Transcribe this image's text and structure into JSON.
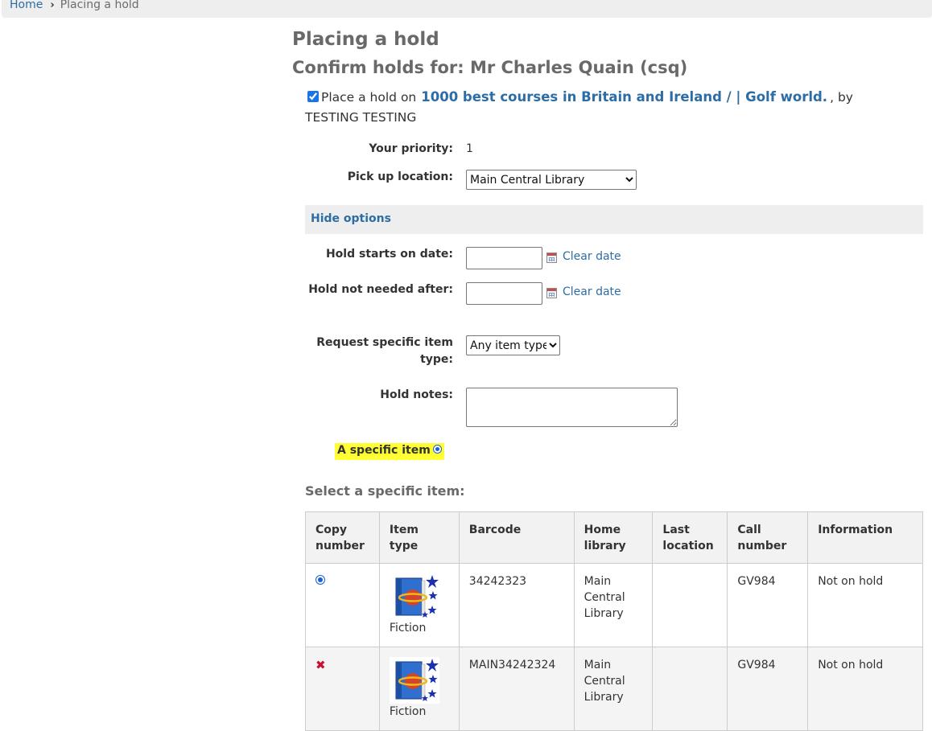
{
  "breadcrumb": {
    "home": "Home",
    "current": "Placing a hold"
  },
  "page_title": "Placing a hold",
  "subtitle": "Confirm holds for: Mr Charles Quain (csq)",
  "hold": {
    "prefix": "Place a hold on",
    "title": "1000 best courses in Britain and Ireland / | Golf world.",
    "suffix": ", by TESTING TESTING"
  },
  "priority": {
    "label": "Your priority:",
    "value": "1"
  },
  "pickup": {
    "label": "Pick up location:",
    "selected": "Main Central Library"
  },
  "options_toggle": "Hide options",
  "start_date": {
    "label": "Hold starts on date:",
    "clear": "Clear date"
  },
  "expiry_date": {
    "label": "Hold not needed after:",
    "clear": "Clear date"
  },
  "item_type": {
    "label": "Request specific item type:",
    "selected": "Any item type"
  },
  "notes": {
    "label": "Hold notes:"
  },
  "specific_item": "A specific item",
  "select_heading": "Select a specific item:",
  "table": {
    "headers": [
      "Copy number",
      "Item type",
      "Barcode",
      "Home library",
      "Last location",
      "Call number",
      "Information"
    ],
    "rows": [
      {
        "item_type": "Fiction",
        "barcode": "34242323",
        "home_library": "Main Central Library",
        "last_location": "",
        "call_number": "GV984",
        "information": "Not on hold"
      },
      {
        "item_type": "Fiction",
        "barcode": "MAIN34242324",
        "home_library": "Main Central Library",
        "last_location": "",
        "call_number": "GV984",
        "information": "Not on hold"
      }
    ]
  },
  "icons": {
    "breadcrumb_sep": "chevron-right-icon",
    "calendar": "calendar-icon",
    "item_type": "fiction-book-icon",
    "unavailable": "x-icon"
  },
  "colors": {
    "link": "#2d6da5",
    "highlight": "#ffff33",
    "error": "#c8102e"
  }
}
